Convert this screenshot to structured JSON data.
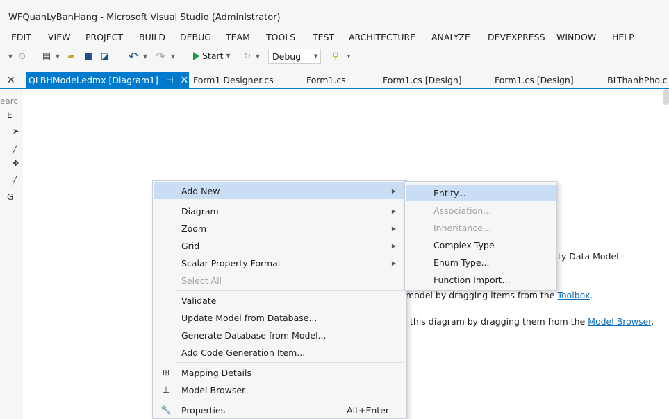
{
  "window": {
    "title": "WFQuanLyBanHang - Microsoft Visual Studio (Administrator)"
  },
  "menu": [
    "EDIT",
    "VIEW",
    "PROJECT",
    "BUILD",
    "DEBUG",
    "TEAM",
    "TOOLS",
    "TEST",
    "ARCHITECTURE",
    "ANALYZE",
    "DEVEXPRESS",
    "WINDOW",
    "HELP"
  ],
  "toolbar": {
    "start_label": "Start",
    "config_value": "Debug"
  },
  "tabs": {
    "active": "QLBHModel.edmx [Diagram1]",
    "pin_icon": "pin-icon",
    "items": [
      "Form1.Designer.cs",
      "Form1.cs",
      "Form1.cs [Design]",
      "Form1.cs [Design]",
      "BLThanhPho.c"
    ]
  },
  "sidepanel": {
    "search_text": "earc",
    "node1": "E",
    "node2": "G"
  },
  "canvas_hints": {
    "line1": "ty Data Model.",
    "line2_prefix": "model by dragging items from the ",
    "line2_link": "Toolbox",
    "line2_suffix": ".",
    "line3_prefix": "this diagram by dragging them from the ",
    "line3_link": "Model Browser",
    "line3_suffix": "."
  },
  "context_menu": {
    "items": [
      {
        "label": "Add New",
        "submenu": true,
        "highlighted": true
      },
      {
        "label": "Diagram",
        "submenu": true
      },
      {
        "label": "Zoom",
        "submenu": true
      },
      {
        "label": "Grid",
        "submenu": true
      },
      {
        "label": "Scalar Property Format",
        "submenu": true
      },
      {
        "label": "Select All",
        "disabled": true
      },
      {
        "label": "Validate"
      },
      {
        "label": "Update Model from Database..."
      },
      {
        "label": "Generate Database from Model..."
      },
      {
        "label": "Add Code Generation Item..."
      },
      {
        "label": "Mapping Details",
        "icon": "mapping-details-icon"
      },
      {
        "label": "Model Browser",
        "icon": "model-browser-icon"
      },
      {
        "label": "Properties",
        "icon": "wrench-icon",
        "shortcut": "Alt+Enter"
      }
    ]
  },
  "submenu": {
    "items": [
      {
        "label": "Entity...",
        "highlighted": true
      },
      {
        "label": "Association...",
        "disabled": true
      },
      {
        "label": "Inheritance...",
        "disabled": true
      },
      {
        "label": "Complex Type"
      },
      {
        "label": "Enum Type..."
      },
      {
        "label": "Function Import..."
      }
    ]
  },
  "colors": {
    "accent": "#007acc",
    "highlight": "#c9def5",
    "link": "#0e70c0",
    "disabled": "#a2a4a5"
  }
}
